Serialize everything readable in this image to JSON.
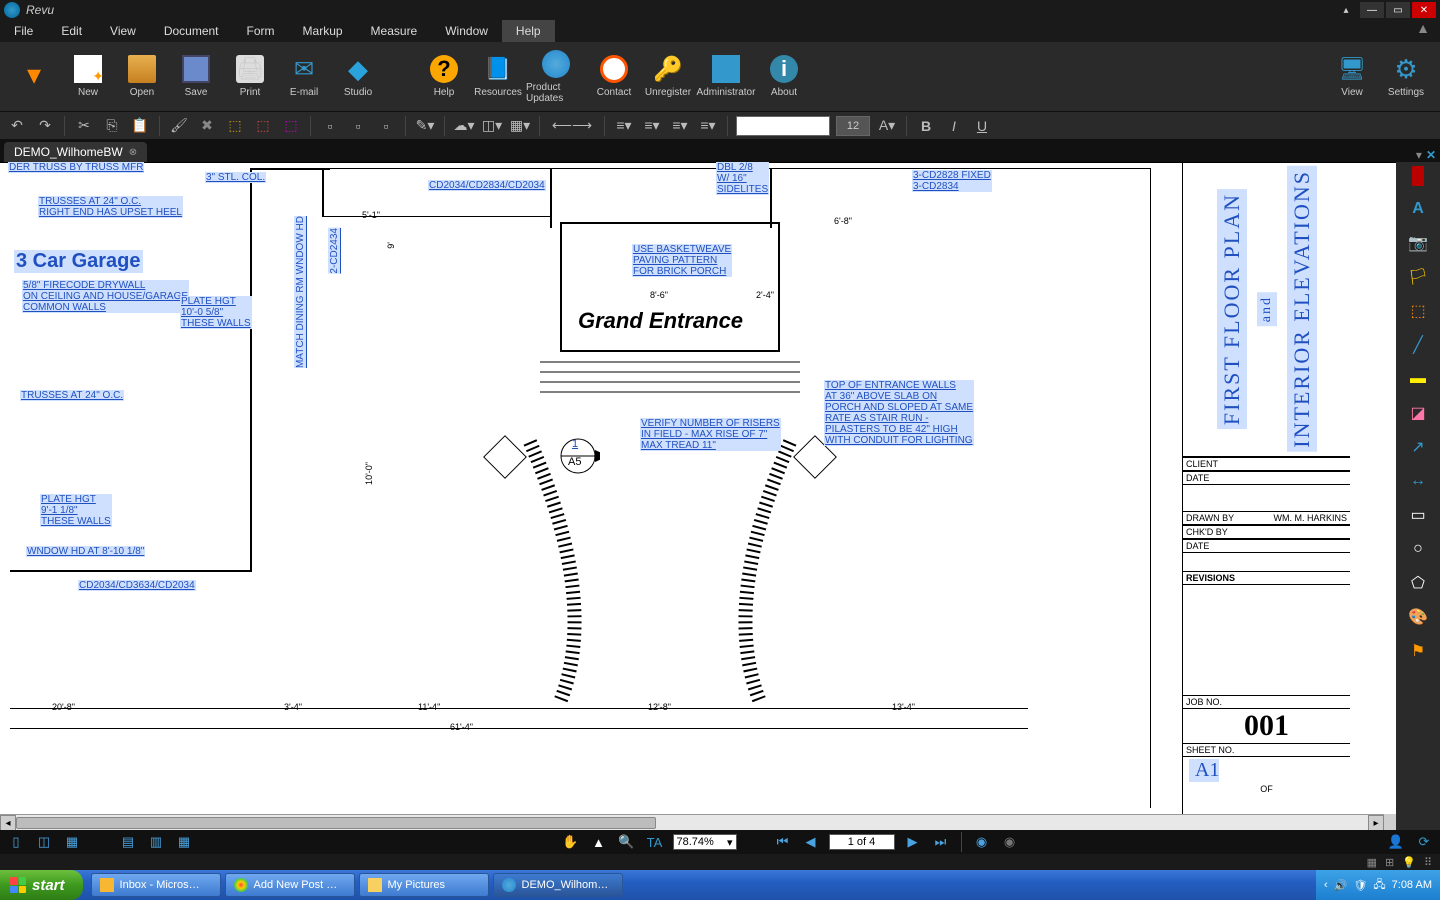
{
  "app": {
    "name": "Revu"
  },
  "window": {
    "minimize": "—",
    "maximize": "▭",
    "close": "✕"
  },
  "menu": {
    "items": [
      "File",
      "Edit",
      "View",
      "Document",
      "Form",
      "Markup",
      "Measure",
      "Window",
      "Help"
    ],
    "selected": "Help"
  },
  "ribbon": {
    "new": "New",
    "open": "Open",
    "save": "Save",
    "print": "Print",
    "email": "E-mail",
    "studio": "Studio",
    "help": "Help",
    "resources": "Resources",
    "updates": "Product Updates",
    "contact": "Contact",
    "unregister": "Unregister",
    "admin": "Administrator",
    "about": "About",
    "view": "View",
    "settings": "Settings"
  },
  "font": {
    "default_size": "12"
  },
  "doc": {
    "tab_label": "DEMO_WilhomeBW"
  },
  "drawing": {
    "title1": "FIRST FLOOR PLAN",
    "title2": "and",
    "title3": "INTERIOR ELEVATIONS",
    "grand": "Grand Entrance",
    "garage": "3 Car Garage",
    "garage_note": "5/8\" FIRECODE DRYWALL\nON CEILING AND HOUSE/GARAGE\nCOMMON WALLS",
    "plate1": "PLATE HGT\n10'-0 5/8\"\nTHESE WALLS",
    "plate2": "PLATE HGT\n9'-1 1/8\"\nTHESE WALLS",
    "trusses1": "TRUSSES AT 24\" O.C.\nRIGHT END HAS UPSET HEEL",
    "trusses2": "TRUSSES AT 24\" O.C.",
    "basketweave": "USE BASKETWEAVE\nPAVING PATTERN\nFOR BRICK PORCH",
    "risers": "VERIFY NUMBER OF RISERS\nIN FIELD - MAX RISE OF 7\"\nMAX TREAD 11\"",
    "entrance_walls": "TOP OF ENTRANCE WALLS\nAT 36\" ABOVE SLAB ON\nPORCH AND SLOPED AT SAME\nRATE AS STAIR RUN -\nPILASTERS TO BE 42\" HIGH\nWITH CONDUIT FOR LIGHTING",
    "stl_col": "3\" STL. COL.",
    "match_window": "MATCH DINING RM WNDOW HD",
    "dbl28": "DBL 2/8\nW/ 16\"\nSIDELITES",
    "cd_fixed": "3-CD2828 FIXED\n3-CD2834",
    "wndow_hd": "WNDOW HD AT 8'-10 1/8\"",
    "cd_bottom": "CD2034/CD3634/CD2034",
    "cd_mid": "CD2034/CD2834/CD2034",
    "two_cd": "2-CD2434",
    "der_truss": "DER TRUSS BY TRUSS MFR",
    "detail_ref_top": "1",
    "detail_ref_bot": "A5",
    "dims": {
      "d1": "5'-1\"",
      "d2": "9'",
      "d3": "8'-6\"",
      "d4": "6'-8\"",
      "d5": "2'-4\"",
      "d6": "10'-0\"",
      "d7": "20'-8\"",
      "d8": "3'-4\"",
      "d9": "11'-4\"",
      "d10": "12'-8\"",
      "d11": "13'-4\"",
      "d12": "61'-4\""
    },
    "tb": {
      "client": "CLIENT",
      "date": "DATE",
      "drawn_by": "DRAWN BY",
      "drawn_by_val": "WM. M. HARKINS",
      "chkd_by": "CHK'D BY",
      "date2": "DATE",
      "revisions": "REVISIONS",
      "job_no": "JOB NO.",
      "job_val": "001",
      "sheet_no": "SHEET NO.",
      "sheet_val": "A1",
      "of": "OF"
    }
  },
  "status": {
    "zoom": "78.74%",
    "page": "1 of 4"
  },
  "taskbar": {
    "start": "start",
    "tasks": [
      "Inbox - Micros…",
      "Add New Post …",
      "My Pictures",
      "DEMO_Wilhom…"
    ],
    "time": "7:08 AM"
  }
}
